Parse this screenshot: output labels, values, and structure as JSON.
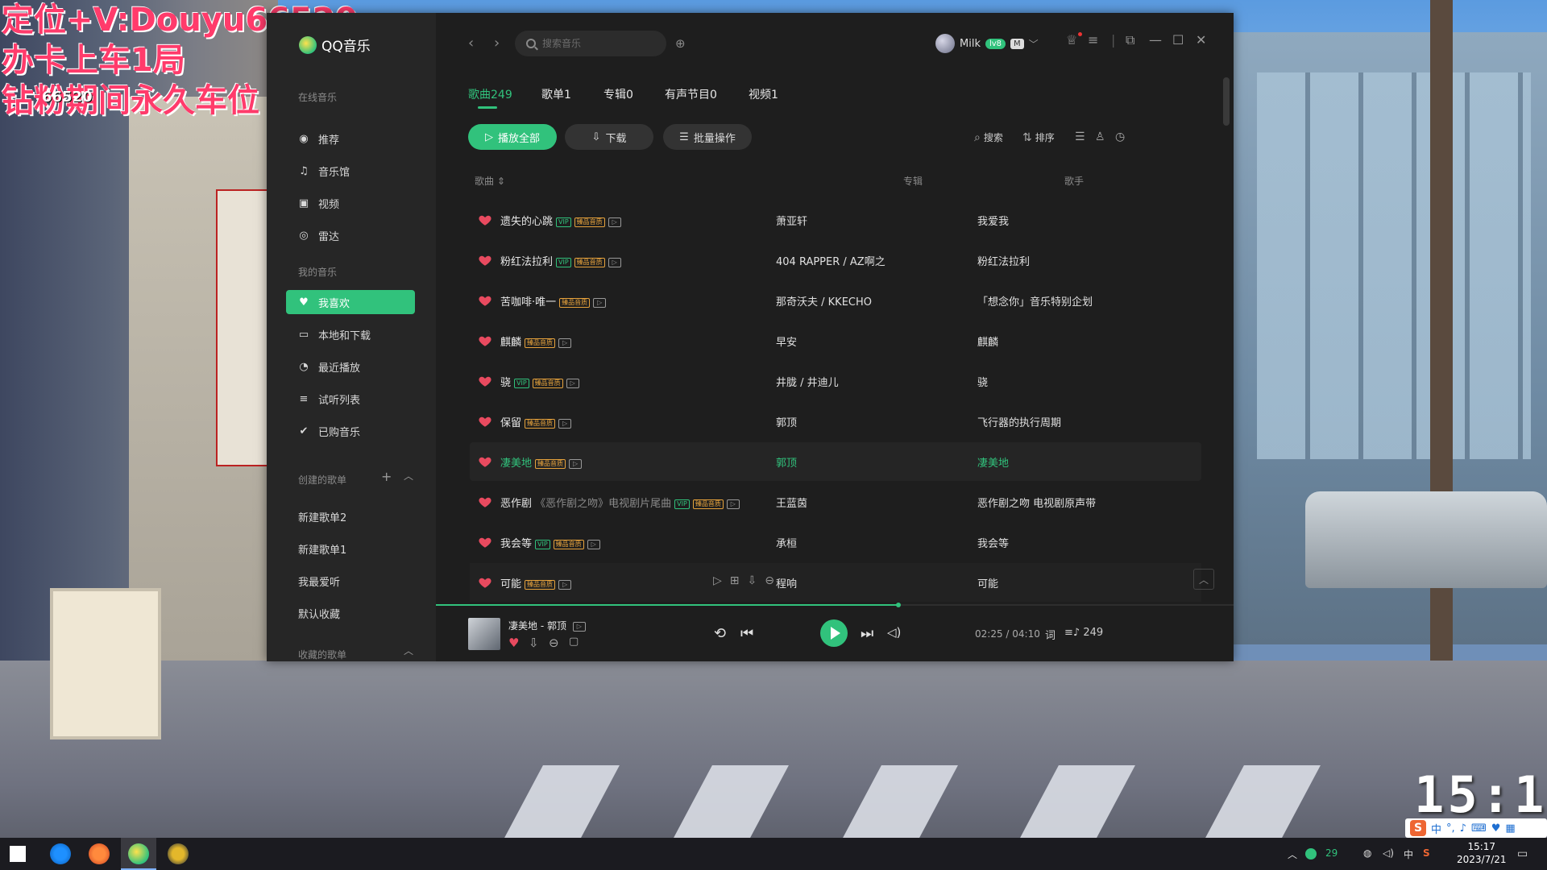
{
  "overlay": {
    "line1": "定位+V:Douyu66520",
    "line2": "办卡上车1局",
    "line3": "钻粉期间永久车位",
    "small": "66520"
  },
  "desktop": {
    "clock": "15:17",
    "ime_label": "中"
  },
  "app": {
    "logo_text": "QQ音乐",
    "search_placeholder": "搜索音乐",
    "user_name": "Milk",
    "user_badge": "lv8",
    "sidebar": {
      "section_online": "在线音乐",
      "online_items": [
        {
          "label": "推荐",
          "icon": "recommend-icon"
        },
        {
          "label": "音乐馆",
          "icon": "music-hall-icon"
        },
        {
          "label": "视频",
          "icon": "video-icon"
        },
        {
          "label": "雷达",
          "icon": "radar-icon"
        }
      ],
      "section_mine": "我的音乐",
      "mine_items": [
        {
          "label": "我喜欢",
          "icon": "heart-icon"
        },
        {
          "label": "本地和下载",
          "icon": "computer-icon"
        },
        {
          "label": "最近播放",
          "icon": "clock-icon"
        },
        {
          "label": "试听列表",
          "icon": "playlist-icon"
        },
        {
          "label": "已购音乐",
          "icon": "check-circle-icon"
        }
      ],
      "section_created": "创建的歌单",
      "created_playlists": [
        "新建歌单2",
        "新建歌单1",
        "我最爱听",
        "默认收藏"
      ],
      "section_collected": "收藏的歌单"
    },
    "tabs": [
      {
        "label": "歌曲249",
        "active": true
      },
      {
        "label": "歌单1"
      },
      {
        "label": "专辑0"
      },
      {
        "label": "有声节目0"
      },
      {
        "label": "视频1"
      }
    ],
    "actions": {
      "play_all": "播放全部",
      "download": "下载",
      "batch": "批量操作",
      "search": "搜索",
      "sort": "排序"
    },
    "columns": {
      "song": "歌曲",
      "artist": "歌手",
      "album": "专辑"
    },
    "songs": [
      {
        "title": "遗失的心跳",
        "sub": "",
        "tags": [
          "vip",
          "hq",
          "mv"
        ],
        "artist": "萧亚轩",
        "album": "我爱我"
      },
      {
        "title": "粉红法拉利",
        "sub": "",
        "tags": [
          "vip",
          "hq",
          "mv"
        ],
        "artist": "404 RAPPER / AZ啊之",
        "album": "粉红法拉利"
      },
      {
        "title": "苦咖啡·唯一",
        "sub": "",
        "tags": [
          "hq",
          "mv"
        ],
        "artist": "那奇沃夫 / KKECHO",
        "album": "「想念你」音乐特别企划"
      },
      {
        "title": "麒麟",
        "sub": "",
        "tags": [
          "hq",
          "mv"
        ],
        "artist": "早安",
        "album": "麒麟"
      },
      {
        "title": "骁",
        "sub": "",
        "tags": [
          "vip",
          "hq",
          "mv"
        ],
        "artist": "井胧 / 井迪儿",
        "album": "骁"
      },
      {
        "title": "保留",
        "sub": "",
        "tags": [
          "hq",
          "mv"
        ],
        "artist": "郭顶",
        "album": "飞行器的执行周期"
      },
      {
        "title": "凄美地",
        "sub": "",
        "tags": [
          "hq",
          "mv"
        ],
        "artist": "郭顶",
        "album": "凄美地",
        "playing": true
      },
      {
        "title": "恶作剧",
        "sub": "《恶作剧之吻》电视剧片尾曲",
        "tags": [
          "vip",
          "hq",
          "mv"
        ],
        "artist": "王蓝茵",
        "album": "恶作剧之吻 电视剧原声带"
      },
      {
        "title": "我会等",
        "sub": "",
        "tags": [
          "vip",
          "hq",
          "mv"
        ],
        "artist": "承桓",
        "album": "我会等"
      },
      {
        "title": "可能",
        "sub": "",
        "tags": [
          "hq",
          "mv"
        ],
        "artist": "程响",
        "album": "可能",
        "hover": true
      }
    ],
    "tag_labels": {
      "vip": "VIP",
      "hq": "臻品音质",
      "mv": "▷"
    },
    "player": {
      "now_playing": "凄美地 - 郭顶",
      "time": "02:25 / 04:10",
      "lyrics_btn": "词",
      "queue_count": "249",
      "progress": 0.58
    },
    "colors": {
      "accent": "#31c27c",
      "bg": "#1e1e1e",
      "sidebar": "#262626"
    }
  },
  "taskbar": {
    "time": "15:17",
    "date": "2023/7/21",
    "tray_ime": "中",
    "tray_badge": "29"
  }
}
